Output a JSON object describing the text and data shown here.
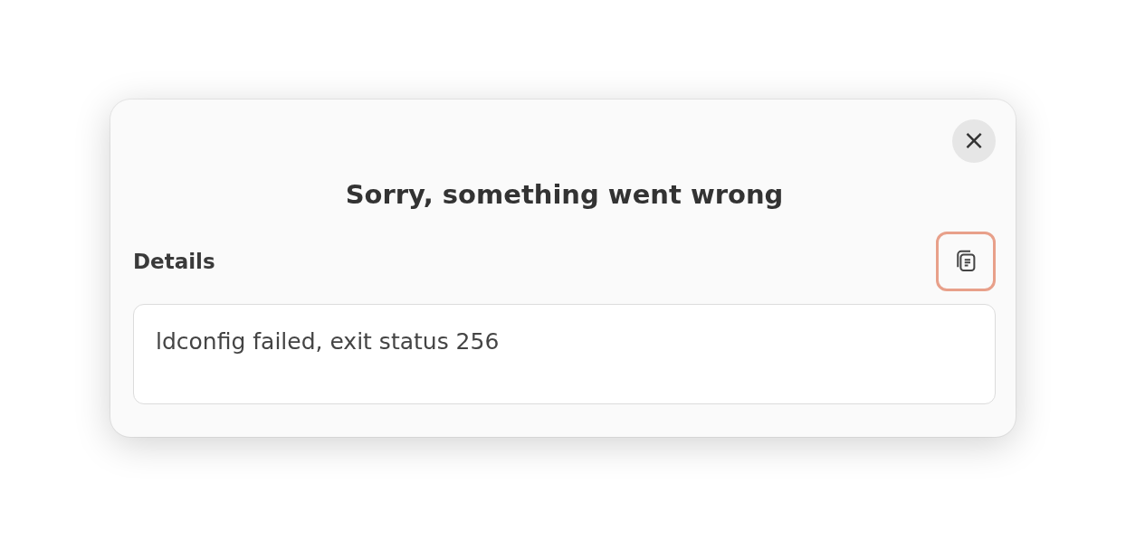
{
  "dialog": {
    "title": "Sorry, something went wrong",
    "close_button": {
      "label": "×"
    },
    "details": {
      "label": "Details",
      "copy_button": {
        "focused": true
      },
      "text": "ldconfig failed, exit status 256"
    }
  }
}
